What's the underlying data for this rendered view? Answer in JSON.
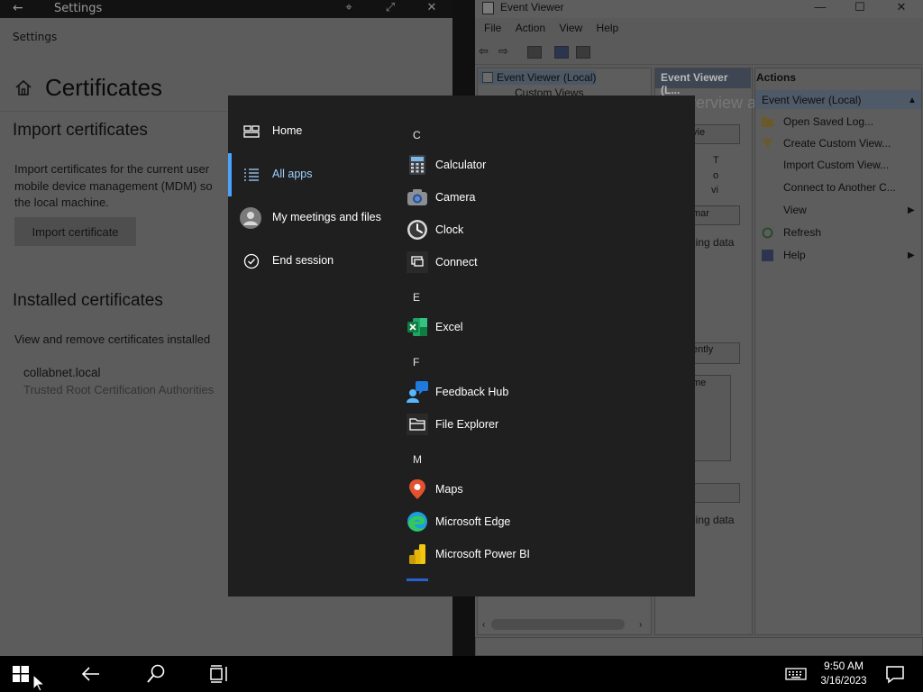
{
  "settings": {
    "window_title": "Settings",
    "breadcrumb": "Settings",
    "page_title": "Certificates",
    "import_heading": "Import certificates",
    "import_desc_line1": "Import certificates for the current user",
    "import_desc_line2": "mobile device management (MDM) so",
    "import_desc_line3": "the local machine.",
    "import_button": "Import certificate",
    "installed_heading": "Installed certificates",
    "installed_desc": "View and remove certificates installed",
    "cert_name": "collabnet.local",
    "cert_store": "Trusted Root Certification Authorities"
  },
  "event_viewer": {
    "window_title": "Event Viewer",
    "menu": [
      "File",
      "Action",
      "View",
      "Help"
    ],
    "tree_root": "Event Viewer (Local)",
    "tree_child": "Custom Views",
    "middle_header": "Event Viewer (L...",
    "middle_overview": "verview a",
    "middle_ghost": {
      "g1": "vie",
      "g2": "mar",
      "g3": "ding data",
      "g4": "ently",
      "g5": "me",
      "g6": "ding data",
      "col_t": "T",
      "col_o": "o",
      "col_vi": "vi"
    },
    "actions_title": "Actions",
    "actions_section": "Event Viewer (Local)",
    "actions": [
      {
        "label": "Open Saved Log...",
        "icon": "folder-icon",
        "has_arrow": false
      },
      {
        "label": "Create Custom View...",
        "icon": "filter-icon",
        "has_arrow": false
      },
      {
        "label": "Import Custom View...",
        "icon": "",
        "has_arrow": false
      },
      {
        "label": "Connect to Another C...",
        "icon": "",
        "has_arrow": false
      },
      {
        "label": "View",
        "icon": "",
        "has_arrow": true
      },
      {
        "label": "Refresh",
        "icon": "refresh-icon",
        "has_arrow": false
      },
      {
        "label": "Help",
        "icon": "help-icon",
        "has_arrow": true
      }
    ]
  },
  "start_menu": {
    "nav": [
      {
        "label": "Home",
        "icon": "home-tiles-icon",
        "active": false
      },
      {
        "label": "All apps",
        "icon": "list-icon",
        "active": true
      },
      {
        "label": "My meetings and files",
        "icon": "avatar-icon",
        "active": false
      },
      {
        "label": "End session",
        "icon": "checkmark-circle-icon",
        "active": false
      }
    ],
    "groups": [
      {
        "letter": "C",
        "apps": [
          "Calculator",
          "Camera",
          "Clock",
          "Connect"
        ]
      },
      {
        "letter": "E",
        "apps": [
          "Excel"
        ]
      },
      {
        "letter": "F",
        "apps": [
          "Feedback Hub",
          "File Explorer"
        ]
      },
      {
        "letter": "M",
        "apps": [
          "Maps",
          "Microsoft Edge",
          "Microsoft Power BI"
        ]
      }
    ],
    "accent_color": "#4aa3ff"
  },
  "taskbar": {
    "time": "9:50 AM",
    "date": "3/16/2023",
    "icons": [
      "windows-start-icon",
      "back-arrow-icon",
      "search-icon",
      "task-view-icon",
      "keyboard-icon",
      "notification-icon"
    ]
  }
}
